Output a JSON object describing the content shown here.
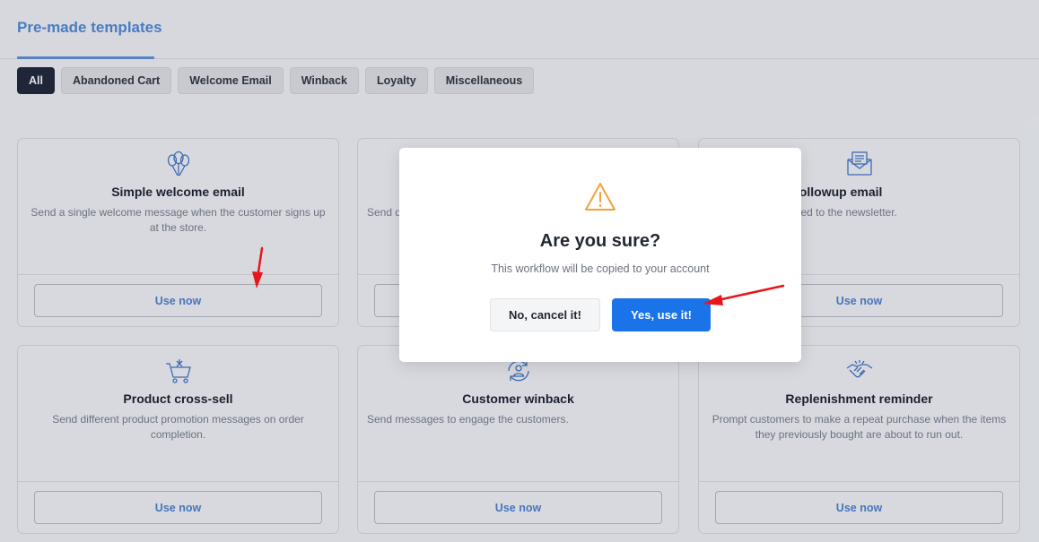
{
  "header": {
    "title": "Pre-made templates"
  },
  "filters": [
    "All",
    "Abandoned Cart",
    "Welcome Email",
    "Winback",
    "Loyalty",
    "Miscellaneous"
  ],
  "active_filter": "All",
  "cards": [
    {
      "icon": "balloons-icon",
      "title": "Simple welcome email",
      "description": "Send a single welcome message when the customer signs up at the store.",
      "button": "Use now"
    },
    {
      "icon": "",
      "title": "",
      "description": "Send d",
      "button": ""
    },
    {
      "icon": "envelope-icon",
      "title": "ewsletter followup email",
      "description": "customer subscribed to the newsletter.",
      "button": "Use now"
    },
    {
      "icon": "cart-icon",
      "title": "Product cross-sell",
      "description": "Send different product promotion messages on order completion.",
      "button": "Use now"
    },
    {
      "icon": "user-refresh-icon",
      "title": "Customer winback",
      "description": "Send messages to engage the customers.",
      "button": "Use now"
    },
    {
      "icon": "handshake-icon",
      "title": "Replenishment reminder",
      "description": "Prompt customers to make a repeat purchase when the items they previously bought are about to run out.",
      "button": "Use now"
    }
  ],
  "modal": {
    "icon": "warning-icon",
    "title": "Are you sure?",
    "message": "This workflow will be copied to your account",
    "cancel_label": "No, cancel it!",
    "confirm_label": "Yes, use it!"
  },
  "colors": {
    "accent": "#4d7fc8",
    "confirm": "#1a73e8",
    "warning": "#f0a23a",
    "annotation": "#e8151b"
  }
}
